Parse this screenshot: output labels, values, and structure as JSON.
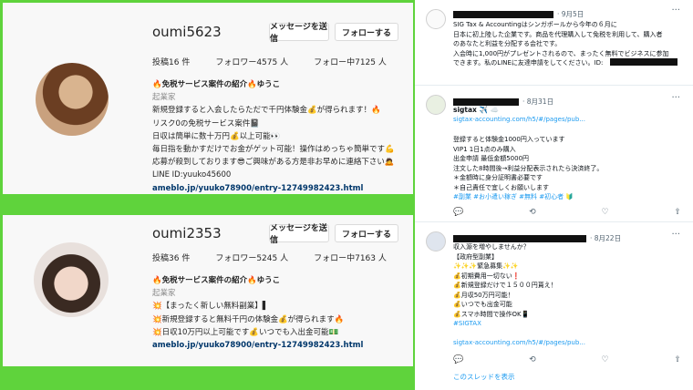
{
  "ig_top": {
    "username": "oumi5623",
    "msg_label": "メッセージを送信",
    "follow_label": "フォローする",
    "more": "···",
    "posts": "投稿16 件",
    "followers": "フォロワー4575 人",
    "following": "フォロー中7125 人",
    "bio_name": "🔥免税サービス案件の紹介🔥ゆうこ",
    "bio_category": "起業家",
    "bio_lines": [
      "新規登録すると入会したらただで千円体験金💰が得られます！🔥",
      "リスク0の免税サービス案件📓",
      "日収は簡単に数十万円💰以上可能👀",
      "毎日指を動かすだけでお金がゲット可能！操作はめっちゃ簡単です💪",
      "応募が殺到しております😎ご興味がある方是非お早めに連絡下さい🙇"
    ],
    "line_id": "LINE ID:yuuko45600",
    "link": "ameblo.jp/yuuko78900/entry-12749982423.html"
  },
  "ig_bot": {
    "username": "oumi2353",
    "msg_label": "メッセージを送信",
    "follow_label": "フォローする",
    "more": "···",
    "posts": "投稿36 件",
    "followers": "フォロワー5245 人",
    "following": "フォロー中7163 人",
    "bio_name": "🔥免税サービス案件の紹介🔥ゆうこ",
    "bio_category": "起業家",
    "bio_lines": [
      "💥【まったく新しい無料副業】▌",
      "💥新規登録すると無料千円の体験金💰が得られます🔥",
      "💥日収10万円以上可能です💰いつでも入出金可能💵"
    ],
    "link": "ameblo.jp/yuuko78900/entry-12749982423.html"
  },
  "tweets": [
    {
      "date": "· 9月5日",
      "text": "SIG Tax & Accountingはシンガポールから今年の６月に\n日本に初上陸した企業です。商品を代理購入して免税を利用して、購入者\nのあなたと利益を分配する会社です。\n入会時に1,000円がプレゼントされるので、まったく無料でビジネスに参加\nできます。私のLINEに友達申請をしてください。ID:"
    },
    {
      "name": "sigtax ✈️ ☁️",
      "date": "· 8月31日",
      "link": "sigtax-accounting.com/h5/#/pages/pub...",
      "text": "登録すると体験金1000円入っています\nVIP1 1日1点のみ購入\n出金申請 最低金額5000円\n注文した8時間後→利益分配表示されたら決済終了。\n＊金額時に身分証明書必要です\n＊自己責任で宜しくお願いします",
      "tags": "#副業 #お小遣い稼ぎ #無料 #初心者 🔰"
    },
    {
      "date": "· 8月22日",
      "text": "収入源を増やしませんか？\n【政府型副業】\n✨✨✨緊急募集✨✨\n💰初期費用一切ない❗\n💰新規登録だけで１５００円貰え！\n💰月収50万円可能！\n💰いつでも出金可能\n💰スマホ時間で操作OK📱",
      "tag": "#SIGTAX",
      "link": "sigtax-accounting.com/h5/#/pages/pub..."
    }
  ],
  "show_thread": "このスレッドを表示",
  "actions": {
    "reply": "💬",
    "retweet": "⟲",
    "like": "♡",
    "share": "⇧"
  }
}
